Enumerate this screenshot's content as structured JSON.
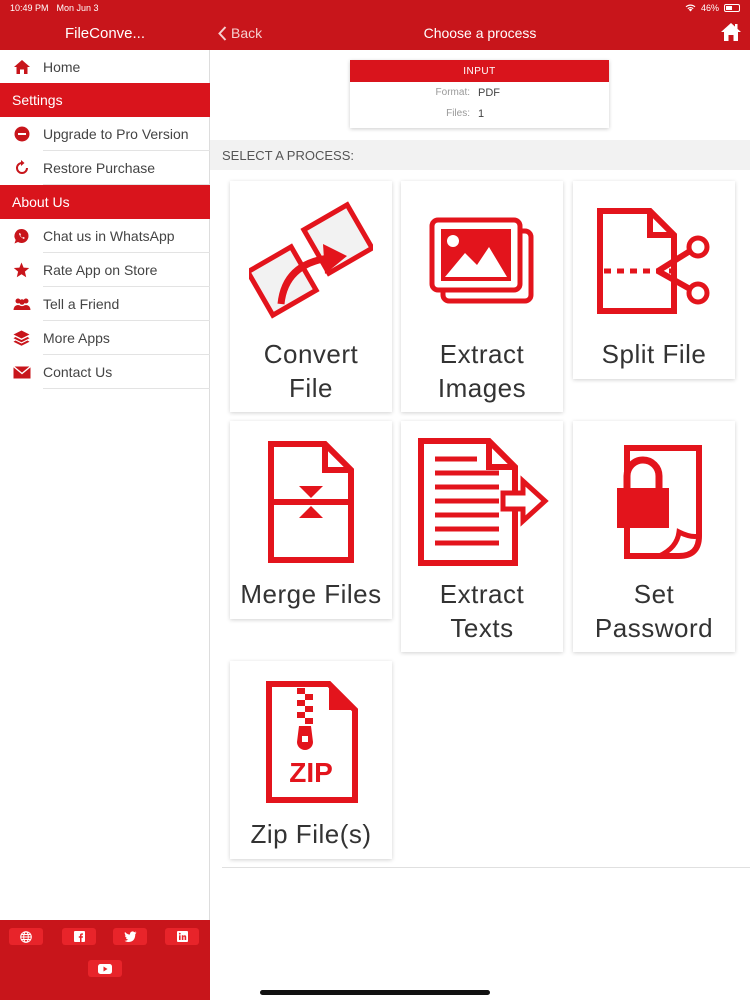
{
  "status": {
    "time": "10:49 PM",
    "date": "Mon Jun 3",
    "battery": "46%"
  },
  "sidebar": {
    "title": "FileConve...",
    "home": "Home",
    "settings_header": "Settings",
    "settings_items": [
      {
        "label": "Upgrade to Pro Version",
        "icon": "minus-circle-icon"
      },
      {
        "label": "Restore Purchase",
        "icon": "refresh-icon"
      }
    ],
    "about_header": "About Us",
    "about_items": [
      {
        "label": "Chat us in WhatsApp",
        "icon": "whatsapp-icon"
      },
      {
        "label": "Rate App on Store",
        "icon": "star-icon"
      },
      {
        "label": "Tell a Friend",
        "icon": "people-icon"
      },
      {
        "label": "More Apps",
        "icon": "layers-icon"
      },
      {
        "label": "Contact Us",
        "icon": "mail-icon"
      }
    ],
    "social": [
      "globe-icon",
      "facebook-icon",
      "twitter-icon",
      "linkedin-icon",
      "youtube-icon"
    ]
  },
  "topbar": {
    "back_label": "Back",
    "title": "Choose a process"
  },
  "input": {
    "header": "INPUT",
    "format_label": "Format:",
    "format_value": "PDF",
    "files_label": "Files:",
    "files_value": "1"
  },
  "section_label": "SELECT A PROCESS:",
  "processes": [
    {
      "label": "Convert\nFile",
      "icon": "convert-file-icon"
    },
    {
      "label": "Extract\nImages",
      "icon": "extract-images-icon"
    },
    {
      "label": "Split File",
      "icon": "split-file-icon"
    },
    {
      "label": "Merge Files",
      "icon": "merge-files-icon"
    },
    {
      "label": "Extract\nTexts",
      "icon": "extract-texts-icon"
    },
    {
      "label": "Set\nPassword",
      "icon": "set-password-icon"
    },
    {
      "label": "Zip File(s)",
      "icon": "zip-file-icon"
    }
  ],
  "colors": {
    "brand": "#c8151b",
    "accent": "#e8242a"
  }
}
